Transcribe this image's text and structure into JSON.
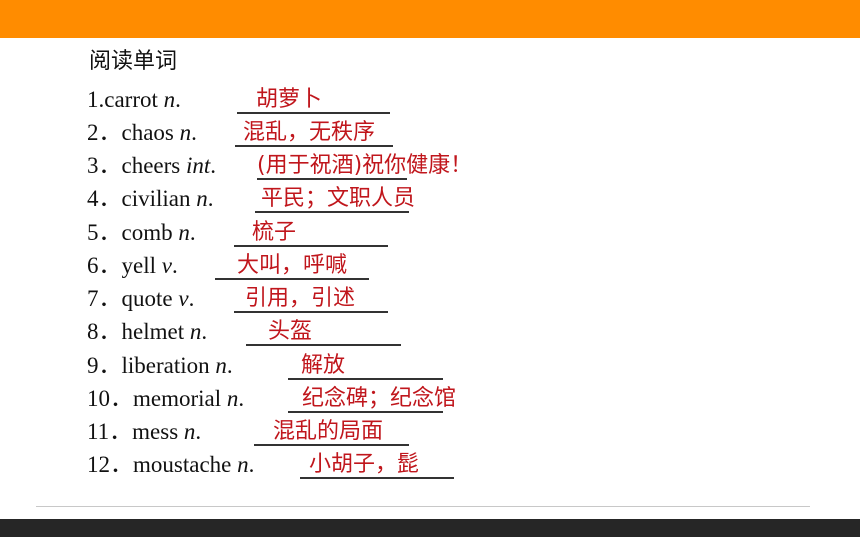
{
  "slide": {
    "heading": "阅读单词",
    "items": [
      {
        "num": "1.",
        "word": "carrot",
        "pos": "n",
        "answer": "胡萝卜"
      },
      {
        "num": "2．",
        "word": "chaos",
        "pos": "n",
        "answer": "混乱，无秩序"
      },
      {
        "num": "3．",
        "word": "cheers",
        "pos": "int",
        "answer": "(用于祝酒)祝你健康！"
      },
      {
        "num": "4．",
        "word": "civilian",
        "pos": "n",
        "answer": "平民；文职人员"
      },
      {
        "num": "5．",
        "word": "comb",
        "pos": "n",
        "answer": "梳子"
      },
      {
        "num": "6．",
        "word": "yell",
        "pos": "v",
        "answer": "大叫，呼喊"
      },
      {
        "num": "7．",
        "word": "quote",
        "pos": "v",
        "answer": "引用，引述"
      },
      {
        "num": "8．",
        "word": "helmet",
        "pos": "n",
        "answer": "头盔"
      },
      {
        "num": "9．",
        "word": "liberation",
        "pos": "n",
        "answer": "解放"
      },
      {
        "num": "10．",
        "word": "memorial",
        "pos": "n",
        "answer": "纪念碑；纪念馆"
      },
      {
        "num": "11．",
        "word": "mess",
        "pos": "n",
        "answer": "混乱的局面"
      },
      {
        "num": "12．",
        "word": "moustache",
        "pos": "n",
        "answer": "小胡子，髭"
      }
    ]
  },
  "colors": {
    "top_bar": "#ff8c00",
    "answer_text": "#c0161c",
    "bottom_bar": "#262626"
  }
}
